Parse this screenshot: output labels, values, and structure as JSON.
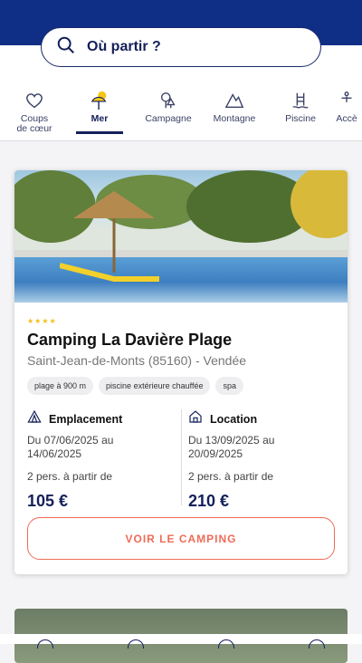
{
  "search": {
    "placeholder": "Où partir ?"
  },
  "categories": [
    {
      "label": "Coups\nde cœur",
      "icon": "heart-icon",
      "active": false
    },
    {
      "label": "Mer",
      "icon": "beach-umbrella-icon",
      "active": true
    },
    {
      "label": "Campagne",
      "icon": "trees-icon",
      "active": false
    },
    {
      "label": "Montagne",
      "icon": "mountain-icon",
      "active": false
    },
    {
      "label": "Piscine",
      "icon": "pool-ladder-icon",
      "active": false
    },
    {
      "label": "Accè",
      "icon": "accessibility-icon",
      "active": false
    }
  ],
  "card": {
    "stars": "★★★★",
    "title": "Camping La Davière Plage",
    "location": "Saint-Jean-de-Monts (85160) - Vendée",
    "tags": [
      "plage à 900 m",
      "piscine extérieure chauffée",
      "spa"
    ],
    "offers": [
      {
        "icon": "tent-icon",
        "title": "Emplacement",
        "dates": "Du 07/06/2025 au\n14/06/2025",
        "from": "2 pers. à partir de",
        "price": "105 €"
      },
      {
        "icon": "house-icon",
        "title": "Location",
        "dates": "Du 13/09/2025 au\n20/09/2025",
        "from": "2 pers. à partir de",
        "price": "210 €"
      }
    ],
    "cta": "VOIR LE CAMPING"
  },
  "colors": {
    "navy": "#14205a",
    "header": "#0f2f86",
    "accent": "#ef6b57",
    "star": "#f2c014"
  }
}
